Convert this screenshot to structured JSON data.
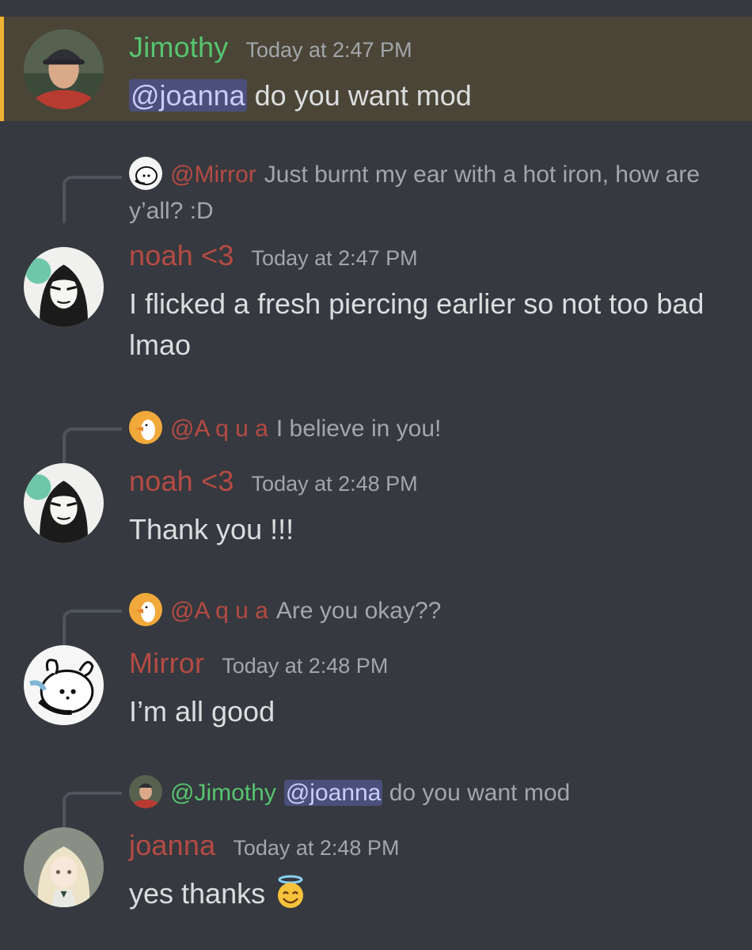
{
  "colors": {
    "jimothy": "#57c46f",
    "red_name": "#b54b44",
    "mention_bg": "#4b4f7a",
    "highlight_bar": "#f0b232"
  },
  "messages": [
    {
      "author": "Jimothy",
      "time": "Today at 2:47 PM",
      "mention": "@joanna",
      "text": " do you want mod"
    },
    {
      "reply_name": "@Mirror",
      "reply_text": "Just burnt my ear with a hot iron, how are y’all? :D",
      "author": "noah <3",
      "time": "Today at 2:47 PM",
      "text": "I flicked a fresh piercing earlier so not too bad lmao"
    },
    {
      "reply_name": "@A q u a",
      "reply_text": "I believe in you!",
      "author": "noah <3",
      "time": "Today at 2:48 PM",
      "text": "Thank you !!!"
    },
    {
      "reply_name": "@A q u a",
      "reply_text": "Are you okay??",
      "author": "Mirror",
      "time": "Today at 2:48 PM",
      "text": "I’m all good"
    },
    {
      "reply_name": "@Jimothy",
      "reply_mention": "@joanna",
      "reply_text": " do you want mod",
      "author": "joanna",
      "time": "Today at 2:48 PM",
      "text": "yes thanks ",
      "emoji": "smiling-face-with-halo"
    }
  ]
}
